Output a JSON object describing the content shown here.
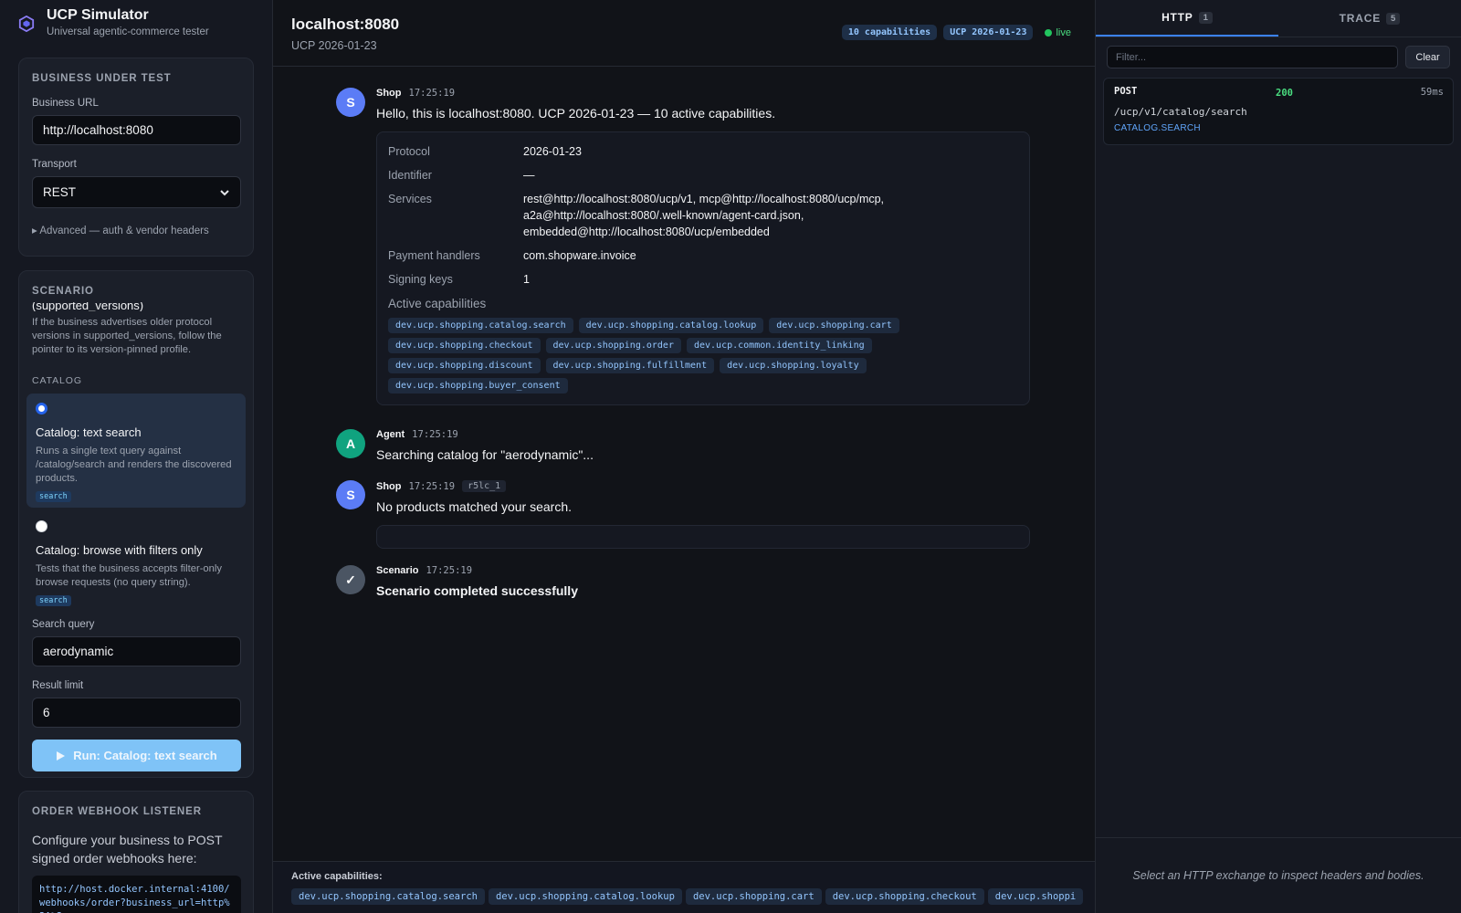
{
  "brand": {
    "title": "UCP Simulator",
    "subtitle": "Universal agentic-commerce tester"
  },
  "business": {
    "title": "BUSINESS UNDER TEST",
    "url_label": "Business URL",
    "url_value": "http://localhost:8080",
    "transport_label": "Transport",
    "transport_value": "REST",
    "advanced": "▸ Advanced — auth & vendor headers"
  },
  "scenario": {
    "title": "SCENARIO",
    "partial_title": "(supported_versions)",
    "partial_desc": "If the business advertises older protocol versions in supported_versions, follow the pointer to its version-pinned profile.",
    "group_label": "CATALOG",
    "items": [
      {
        "title": "Catalog: text search",
        "desc": "Runs a single text query against /catalog/search and renders the discovered products.",
        "tag": "search"
      },
      {
        "title": "Catalog: browse with filters only",
        "desc": "Tests that the business accepts filter-only browse requests (no query string).",
        "tag": "search"
      }
    ],
    "query_label": "Search query",
    "query_value": "aerodynamic",
    "limit_label": "Result limit",
    "limit_value": "6",
    "run_label": "Run: Catalog: text search"
  },
  "webhook": {
    "title": "ORDER WEBHOOK LISTENER",
    "desc": "Configure your business to POST signed order webhooks here:",
    "url": "http://host.docker.internal:4100/webhooks/order?business_url=http%3A%2"
  },
  "header": {
    "title": "localhost:8080",
    "subtitle": "UCP 2026-01-23",
    "badge_caps": "10 capabilities",
    "badge_ucp": "UCP 2026-01-23",
    "live": "live"
  },
  "messages": {
    "m1": {
      "sender": "Shop",
      "avatar": "S",
      "time": "17:25:19",
      "text": "Hello, this is localhost:8080. UCP 2026-01-23 — 10 active capabilities.",
      "rows": [
        {
          "k": "Protocol",
          "v": "2026-01-23"
        },
        {
          "k": "Identifier",
          "v": "—"
        },
        {
          "k": "Services",
          "v": "rest@http://localhost:8080/ucp/v1, mcp@http://localhost:8080/ucp/mcp, a2a@http://localhost:8080/.well-known/agent-card.json, embedded@http://localhost:8080/ucp/embedded"
        },
        {
          "k": "Payment handlers",
          "v": "com.shopware.invoice"
        },
        {
          "k": "Signing keys",
          "v": "1"
        }
      ],
      "caps_title": "Active capabilities"
    },
    "m2": {
      "sender": "Agent",
      "avatar": "A",
      "time": "17:25:19",
      "text": "Searching catalog for \"aerodynamic\"..."
    },
    "m3": {
      "sender": "Shop",
      "avatar": "S",
      "time": "17:25:19",
      "ref": "r5lc_1",
      "text": "No products matched your search."
    },
    "m4": {
      "sender": "Scenario",
      "avatar": "✓",
      "time": "17:25:19",
      "text": "Scenario completed successfully"
    }
  },
  "capabilities": [
    "dev.ucp.shopping.catalog.search",
    "dev.ucp.shopping.catalog.lookup",
    "dev.ucp.shopping.cart",
    "dev.ucp.shopping.checkout",
    "dev.ucp.shopping.order",
    "dev.ucp.common.identity_linking",
    "dev.ucp.shopping.discount",
    "dev.ucp.shopping.fulfillment",
    "dev.ucp.shopping.loyalty",
    "dev.ucp.shopping.buyer_consent"
  ],
  "bottom": {
    "label": "Active capabilities:",
    "visible_caps": [
      "dev.ucp.shopping.catalog.search",
      "dev.ucp.shopping.catalog.lookup",
      "dev.ucp.shopping.cart",
      "dev.ucp.shopping.checkout",
      "dev.ucp.shoppi"
    ]
  },
  "inspector": {
    "tab_http": "HTTP",
    "tab_http_count": "1",
    "tab_trace": "TRACE",
    "tab_trace_count": "5",
    "filter_placeholder": "Filter...",
    "clear": "Clear",
    "exchange": {
      "method": "POST",
      "status": "200",
      "time": "59ms",
      "path": "/ucp/v1/catalog/search",
      "op": "CATALOG.SEARCH"
    },
    "empty": "Select an HTTP exchange to inspect headers and bodies."
  },
  "colors": {
    "accent": "#3b82f6",
    "shop_avatar": "#5b7cf6",
    "agent_avatar": "#10a37f",
    "scenario_avatar": "#4b5563",
    "success": "#4ade80"
  }
}
